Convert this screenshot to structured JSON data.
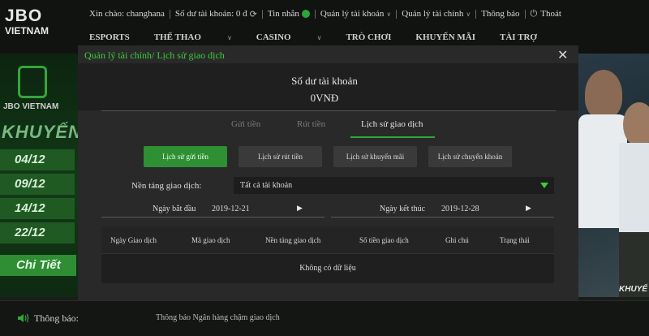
{
  "header": {
    "logo_line1": "JBO",
    "logo_line2": "VIETNAM",
    "greeting": "Xin chào: changhana",
    "balance_label": "Số dư tài khoản: 0 đ",
    "messages": "Tin nhắn",
    "account_mgmt": "Quản lý tài khoản",
    "finance_mgmt": "Quản lý tài chính",
    "notification": "Thông báo",
    "logout": "Thoát"
  },
  "nav": [
    "ESPORTS",
    "THỂ THAO",
    "CASINO",
    "TRÒ CHƠI",
    "KHUYẾN MÃI",
    "TÀI TRỢ"
  ],
  "promo": {
    "brand": "JBO VIETNAM",
    "title": "KHUYẾN",
    "dates": [
      "04/12",
      "09/12",
      "14/12",
      "22/12"
    ],
    "cta": "Chi Tiết"
  },
  "photo_promo_text": "KHUYẾ",
  "notice": {
    "label": "Thông báo:",
    "message": "Thông báo Ngân hàng chậm giao dịch"
  },
  "modal": {
    "breadcrumb": "Quản lý tài chính/ Lịch sử giao dịch",
    "close": "✕",
    "balance_title": "Số dư tài khoản",
    "balance_value": "0VNĐ",
    "tabs": [
      "Gửi tiền",
      "Rút tiền",
      "Lịch sử giao dịch"
    ],
    "active_tab": "Lịch sử giao dịch",
    "sub_buttons": [
      "Lịch sử gửi tiền",
      "Lịch sử rút tiền",
      "Lịch sử khuyến mãi",
      "Lịch sử chuyển khoản"
    ],
    "platform_label": "Nền tảng giao dịch:",
    "platform_value": "Tất cả tài khoản",
    "start_label": "Ngày bắt đầu",
    "start_value": "2019-12-21",
    "end_label": "Ngày kết thúc",
    "end_value": "2019-12-28",
    "columns": [
      "Ngày Giao dịch",
      "Mã giao dịch",
      "Nền tảng giao dịch",
      "Số tiền giao dịch",
      "Ghi chú",
      "Trạng thái"
    ],
    "empty_text": "Không có dữ liệu"
  },
  "colors": {
    "accent_green": "#2e8f33",
    "title_green": "#3dcc3d",
    "modal_bg": "#292929"
  }
}
